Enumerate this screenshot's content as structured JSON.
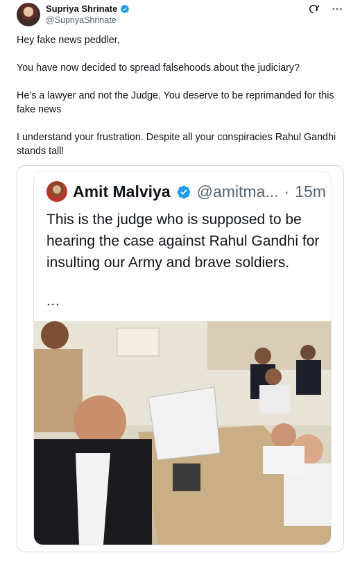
{
  "author": {
    "name": "Supriya Shrinate",
    "handle": "@SupriyaShrinate",
    "verified": true
  },
  "actions": {
    "grok_icon": "grok-icon",
    "more_icon": "more-icon"
  },
  "tweet": {
    "paragraphs": [
      "Hey fake news peddler,",
      "You have now decided to spread falsehoods about the judiciary?",
      "He’s a lawyer and not the Judge. You deserve to be reprimanded for this fake news",
      "I understand your frustration. Despite all your conspiracies Rahul Gandhi stands tall!"
    ]
  },
  "quoted": {
    "name": "Amit Malviya",
    "handle": "@amitma...",
    "separator": "·",
    "time": "15m",
    "verified": true,
    "text": "This is the judge who is supposed to be hearing the case against Rahul Gandhi for insulting our Army and brave soldiers.",
    "ellipsis": "..."
  },
  "colors": {
    "verified_blue": "#1d9bf0",
    "text": "#0f1419",
    "secondary": "#536471",
    "border": "#cfd9de"
  }
}
